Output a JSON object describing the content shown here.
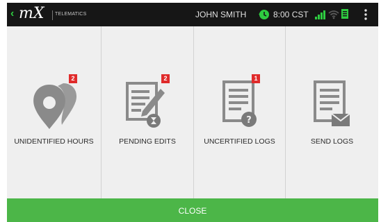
{
  "statusbar": {
    "logo_text": "mX",
    "logo_sub": "TELEMATICS",
    "user_name": "JOHN SMITH",
    "time": "8:00 CST",
    "accent": "#2ecc40"
  },
  "tiles": [
    {
      "label": "UNIDENTIFIED HOURS",
      "badge": "2",
      "icon": "location-pins-icon"
    },
    {
      "label": "PENDING EDITS",
      "badge": "2",
      "icon": "document-edit-icon"
    },
    {
      "label": "UNCERTIFIED LOGS",
      "badge": "1",
      "icon": "document-question-icon"
    },
    {
      "label": "SEND LOGS",
      "badge": "",
      "icon": "document-mail-icon"
    }
  ],
  "footer": {
    "close_label": "CLOSE",
    "color": "#4cb648"
  },
  "colors": {
    "badge": "#e02b2b",
    "icon": "#8a8a8a",
    "status_bar": "#161616",
    "panel": "#efefef"
  }
}
